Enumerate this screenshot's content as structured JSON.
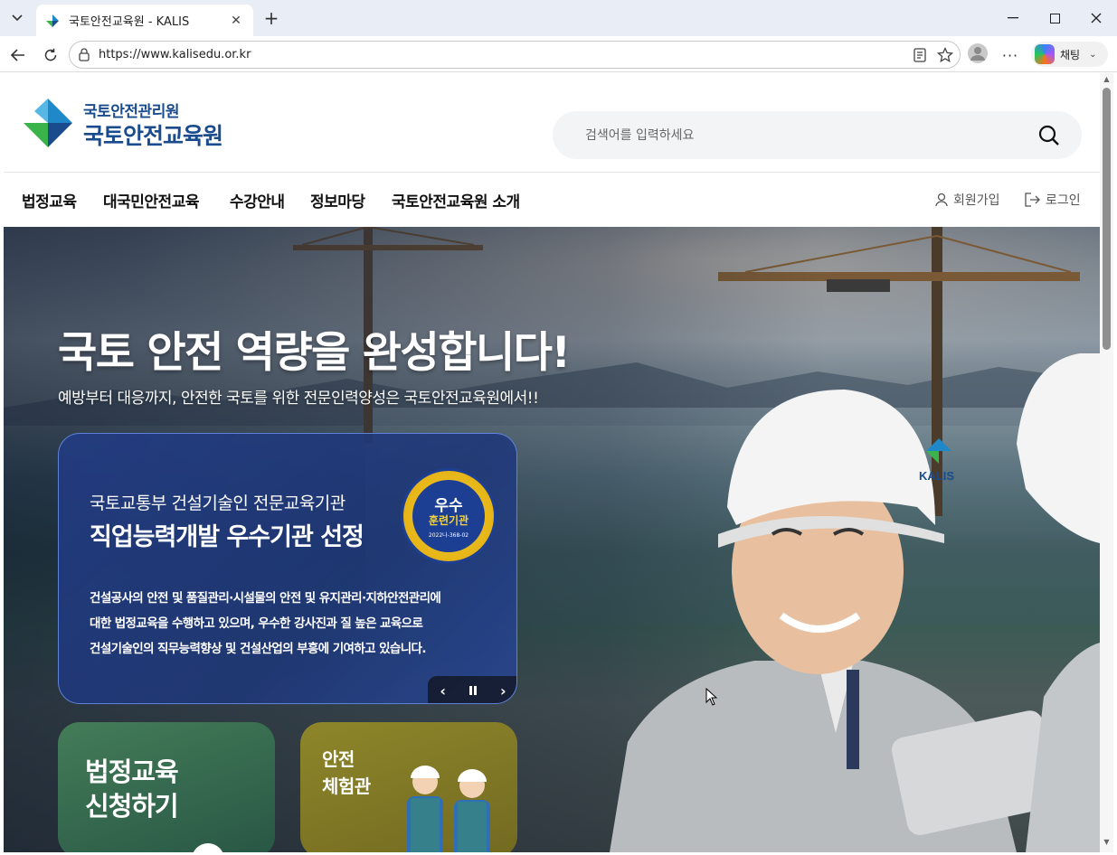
{
  "browser": {
    "tab_title": "국토안전교육원 - KALIS",
    "url": "https://www.kalisedu.or.kr",
    "copilot_label": "채팅"
  },
  "header": {
    "logo_sub": "국토안전관리원",
    "logo_main": "국토안전교육원",
    "search_placeholder": "검색어를 입력하세요"
  },
  "nav": {
    "items": [
      "법정교육",
      "대국민안전교육",
      "수강안내",
      "정보마당",
      "국토안전교육원 소개"
    ],
    "signup": "회원가입",
    "login": "로그인"
  },
  "hero": {
    "title": "국토 안전 역량을 완성합니다!",
    "subtitle": "예방부터 대응까지, 안전한 국토를 위한 전문인력양성은 국토안전교육원에서!!",
    "slide": {
      "kicker": "국토교통부 건설기술인 전문교육기관",
      "headline": "직업능력개발 우수기관 선정",
      "body": [
        "건설공사의 안전 및 품질관리·시설물의 안전 및 유지관리·지하안전관리에",
        "대한 법정교육을 수행하고 있으며, 우수한 강사진과 질 높은 교육으로",
        "건설기술인의 직무능력향상 및 건설산업의 부흥에 기여하고 있습니다."
      ],
      "badge_top": "우수",
      "badge_mid": "훈련기관",
      "badge_small": "2022나-368-02"
    },
    "quick": {
      "q1_line1": "법정교육",
      "q1_line2": "신청하기",
      "q2_line1": "안전",
      "q2_line2": "체험관"
    },
    "helmet_text": "KALIS"
  },
  "colors": {
    "brand_blue": "#1a4b8c",
    "logo_green": "#3ab34a",
    "logo_blue": "#1e88c9",
    "slide_bg": "#233c82"
  }
}
